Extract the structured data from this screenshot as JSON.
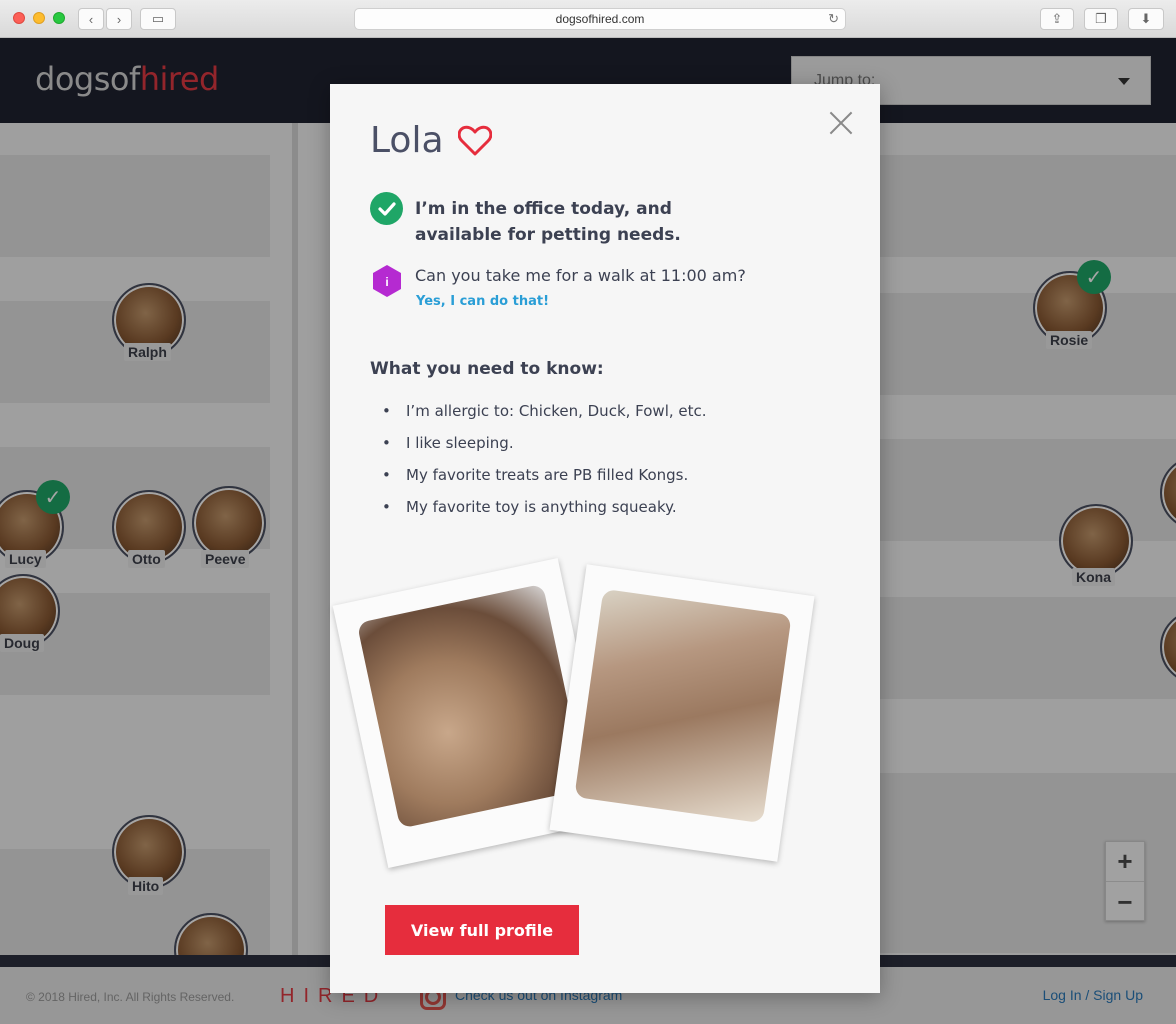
{
  "browser": {
    "url": "dogsofhired.com"
  },
  "site": {
    "logo_part1": "dogsof",
    "logo_part2": "hired",
    "jump_placeholder": "Jump to:"
  },
  "map_dogs": [
    {
      "name": "Ralph"
    },
    {
      "name": "Lucy"
    },
    {
      "name": "Otto"
    },
    {
      "name": "Peeve"
    },
    {
      "name": "Doug"
    },
    {
      "name": "Hito"
    },
    {
      "name": "Rosie"
    },
    {
      "name": "Kona"
    }
  ],
  "zoom": {
    "in": "+",
    "out": "−"
  },
  "footer": {
    "copyright": "© 2018 Hired, Inc. All Rights Reserved.",
    "brand": "HIRED",
    "instagram": "Check us out on Instagram",
    "login": "Log In / Sign Up"
  },
  "modal": {
    "name": "Lola",
    "status": "I’m in the office today, and available for petting needs.",
    "walk_question": "Can you take me for a walk at 11:00 am?",
    "walk_answer": "Yes, I can do that!",
    "know_title": "What you need to know:",
    "facts": [
      "I’m allergic to: Chicken, Duck, Fowl, etc.",
      "I like sleeping.",
      "My favorite treats are PB filled Kongs.",
      "My favorite toy is anything squeaky."
    ],
    "button": "View full profile",
    "colors": {
      "accent": "#e62d3d",
      "available": "#1fa667",
      "info": "#b52ad1",
      "link": "#2a9ed6"
    }
  }
}
